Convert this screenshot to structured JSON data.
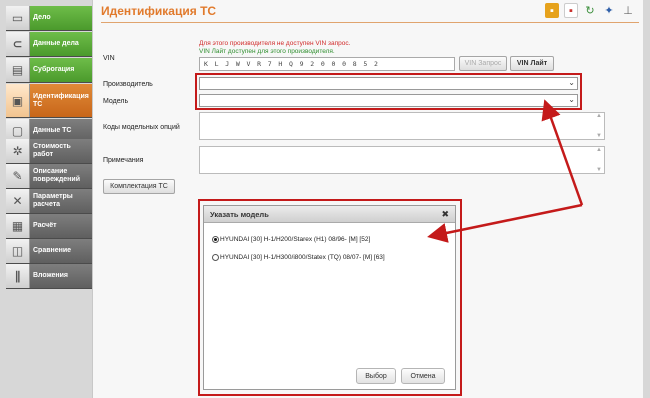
{
  "sidebar": {
    "items": [
      {
        "label": "Дело",
        "icon": "doc-icon",
        "glyph": "▭"
      },
      {
        "label": "Данные дела",
        "icon": "paperclip-icon",
        "glyph": "⊂"
      },
      {
        "label": "Суброгация",
        "icon": "folder-icon",
        "glyph": "▤"
      },
      {
        "label": "Идентификация\nТС",
        "icon": "car-icon",
        "glyph": "▣"
      },
      {
        "label": "Данные ТС",
        "icon": "car-data-icon",
        "glyph": "▢"
      },
      {
        "label": "Стоимость\nработ",
        "icon": "gears-icon",
        "glyph": "✲"
      },
      {
        "label": "Описание\nповреждений",
        "icon": "wrench-icon",
        "glyph": "✎"
      },
      {
        "label": "Параметры\nрасчета",
        "icon": "tools-icon",
        "glyph": "✕"
      },
      {
        "label": "Расчёт",
        "icon": "calculator-icon",
        "glyph": "▦"
      },
      {
        "label": "Сравнение",
        "icon": "compare-icon",
        "glyph": "◫"
      },
      {
        "label": "Вложения",
        "icon": "attachment-icon",
        "glyph": "∥"
      }
    ]
  },
  "page": {
    "title": "Идентификация ТС",
    "toolbar_icons": [
      {
        "name": "save-icon",
        "glyph": "▪",
        "color": "#e6a21c"
      },
      {
        "name": "pdf-icon",
        "glyph": "▪",
        "color": "#c9302c"
      },
      {
        "name": "refresh-icon",
        "glyph": "↻",
        "color": "#3a8e3a"
      },
      {
        "name": "network-icon",
        "glyph": "✦",
        "color": "#2f5fa8"
      },
      {
        "name": "lock-icon",
        "glyph": "⊥",
        "color": "#666666"
      }
    ]
  },
  "vin": {
    "label": "VIN",
    "value": "K L J W V R 7 H Q 9 2 0 0 0 8 5 2",
    "msg_unavailable": "Для этого производителя не доступен VIN запрос.",
    "msg_lite": "VIN Лайт доступен для этого производителя.",
    "btn_request": "VIN Запрос",
    "btn_lite": "VIN Лайт"
  },
  "form": {
    "manufacturer_label": "Производитель",
    "model_label": "Модель",
    "options_label": "Коды модельных опций",
    "notes_label": "Примечания",
    "equipment_button": "Комплектация ТС"
  },
  "dialog": {
    "title": "Указать модель",
    "options": [
      {
        "label": "HYUNDAI [30] H-1/H200/Starex (H1) 08/96-  [M] [52]",
        "selected": true
      },
      {
        "label": "HYUNDAI [30] H-1/H300/i800/Statex (TQ) 08/07-  [M] [63]",
        "selected": false
      }
    ],
    "select_button": "Выбор",
    "cancel_button": "Отмена"
  },
  "colors": {
    "accent": "#e17a2c",
    "highlight": "#c41a1a",
    "sidebar_green": "#4b9a2c"
  }
}
